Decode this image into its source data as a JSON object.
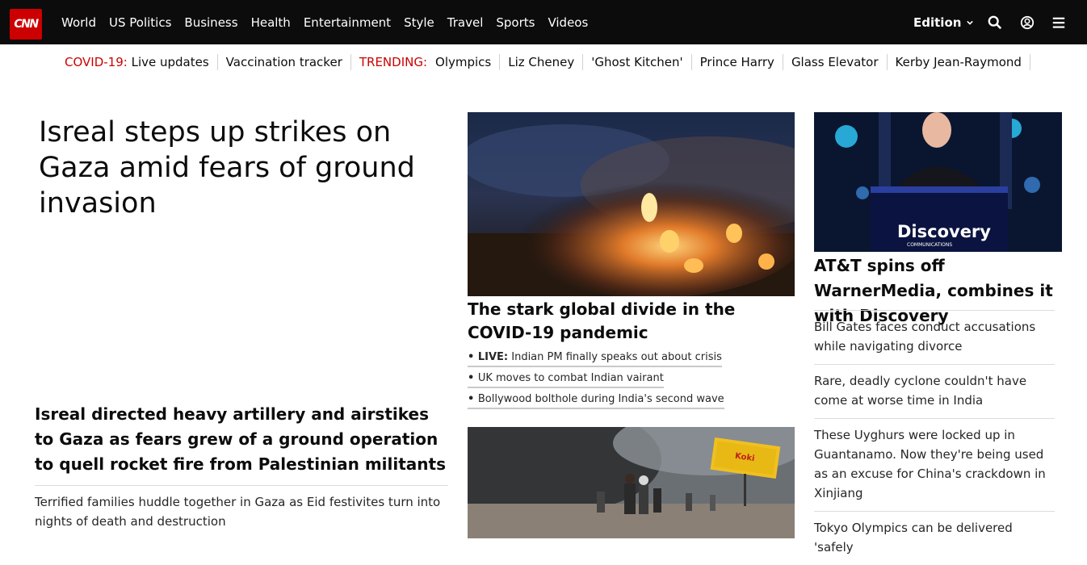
{
  "brand": {
    "logo_text": "CNN",
    "accent": "#cc0000",
    "nav_bg": "#0c0c0c"
  },
  "nav": {
    "links": [
      "World",
      "US Politics",
      "Business",
      "Health",
      "Entertainment",
      "Style",
      "Travel",
      "Sports",
      "Videos"
    ],
    "edition_label": "Edition",
    "icons": [
      "search-icon",
      "user-icon",
      "menu-icon"
    ]
  },
  "trending": {
    "covid_label": "COVID-19:",
    "covid_link": "Live updates",
    "vaccine_link": "Vaccination tracker",
    "trending_label": "TRENDING:",
    "topics": [
      "Olympics",
      "Liz Cheney",
      "'Ghost Kitchen'",
      "Prince Harry",
      "Glass Elevator",
      "Kerby Jean-Raymond"
    ]
  },
  "lead": {
    "headline": "Isreal steps up strikes on Gaza amid fears of ground invasion",
    "subhead": "Isreal directed heavy artillery and airstikes to Gaza as fears grew of a ground operation to quell rocket fire from Palestinian militants",
    "related": [
      "Terrified families huddle together in Gaza as Eid festivites turn into nights of death and destruction"
    ]
  },
  "middle": {
    "title": "The stark global divide in the COVID-19 pandemic",
    "bullet_live_label": "LIVE:",
    "bullets": [
      "Indian PM finally speaks out about crisis",
      "UK moves to combat Indian vairant",
      "Bollywood bolthole during India's second wave"
    ],
    "billboard_text": "Koki"
  },
  "right": {
    "logo_text": "Discovery",
    "logo_subtext": "COMMUNICATIONS",
    "title": "AT&T spins off WarnerMedia, combines it with Discovery",
    "stories": [
      "Bill Gates faces conduct accusations while navigating divorce",
      "Rare, deadly cyclone couldn't have come at worse time in India",
      "These Uyghurs were locked up in Guantanamo. Now they're being used as an excuse for China's crackdown in Xinjiang",
      "Tokyo Olympics can be delivered 'safely"
    ]
  }
}
